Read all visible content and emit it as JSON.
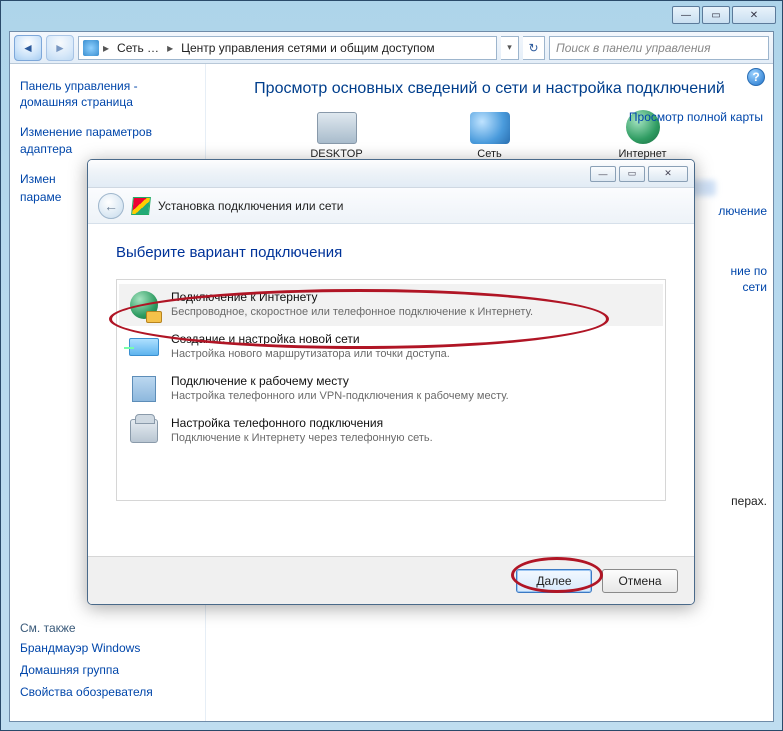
{
  "window": {
    "min_icon": "—",
    "max_icon": "▭",
    "close_icon": "✕"
  },
  "nav": {
    "back_icon": "◄",
    "fwd_icon": "►",
    "refresh_icon": "↻",
    "drop_icon": "▾",
    "sep": "▸",
    "crumb1": "Сеть …",
    "crumb2": "Центр управления сетями и общим доступом"
  },
  "search": {
    "placeholder": "Поиск в панели управления"
  },
  "sidebar": {
    "items": [
      "Панель управления - домашняя страница",
      "Изменение параметров адаптера",
      "Измен",
      "параме"
    ],
    "see_also_label": "См. также",
    "see_also": [
      "Брандмауэр Windows",
      "Домашняя группа",
      "Свойства обозревателя"
    ]
  },
  "page": {
    "title": "Просмотр основных сведений о сети и настройка подключений",
    "map_link": "Просмотр полной карты",
    "nodes": [
      "DESKTOP",
      "Сеть",
      "Интернет"
    ],
    "frag1": "лючение",
    "frag2": "ние по",
    "frag3": "сети",
    "frag4": "перах."
  },
  "wizard": {
    "title": "Установка подключения или сети",
    "heading": "Выберите вариант подключения",
    "back_icon": "←",
    "min_icon": "—",
    "max_icon": "▭",
    "close_icon": "✕",
    "options": [
      {
        "title": "Подключение к Интернету",
        "desc": "Беспроводное, скоростное или телефонное подключение к Интернету."
      },
      {
        "title": "Создание и настройка новой сети",
        "desc": "Настройка нового маршрутизатора или точки доступа."
      },
      {
        "title": "Подключение к рабочему месту",
        "desc": "Настройка телефонного или VPN-подключения к рабочему месту."
      },
      {
        "title": "Настройка телефонного подключения",
        "desc": "Подключение к Интернету через телефонную сеть."
      }
    ],
    "next": "Далее",
    "cancel": "Отмена"
  }
}
